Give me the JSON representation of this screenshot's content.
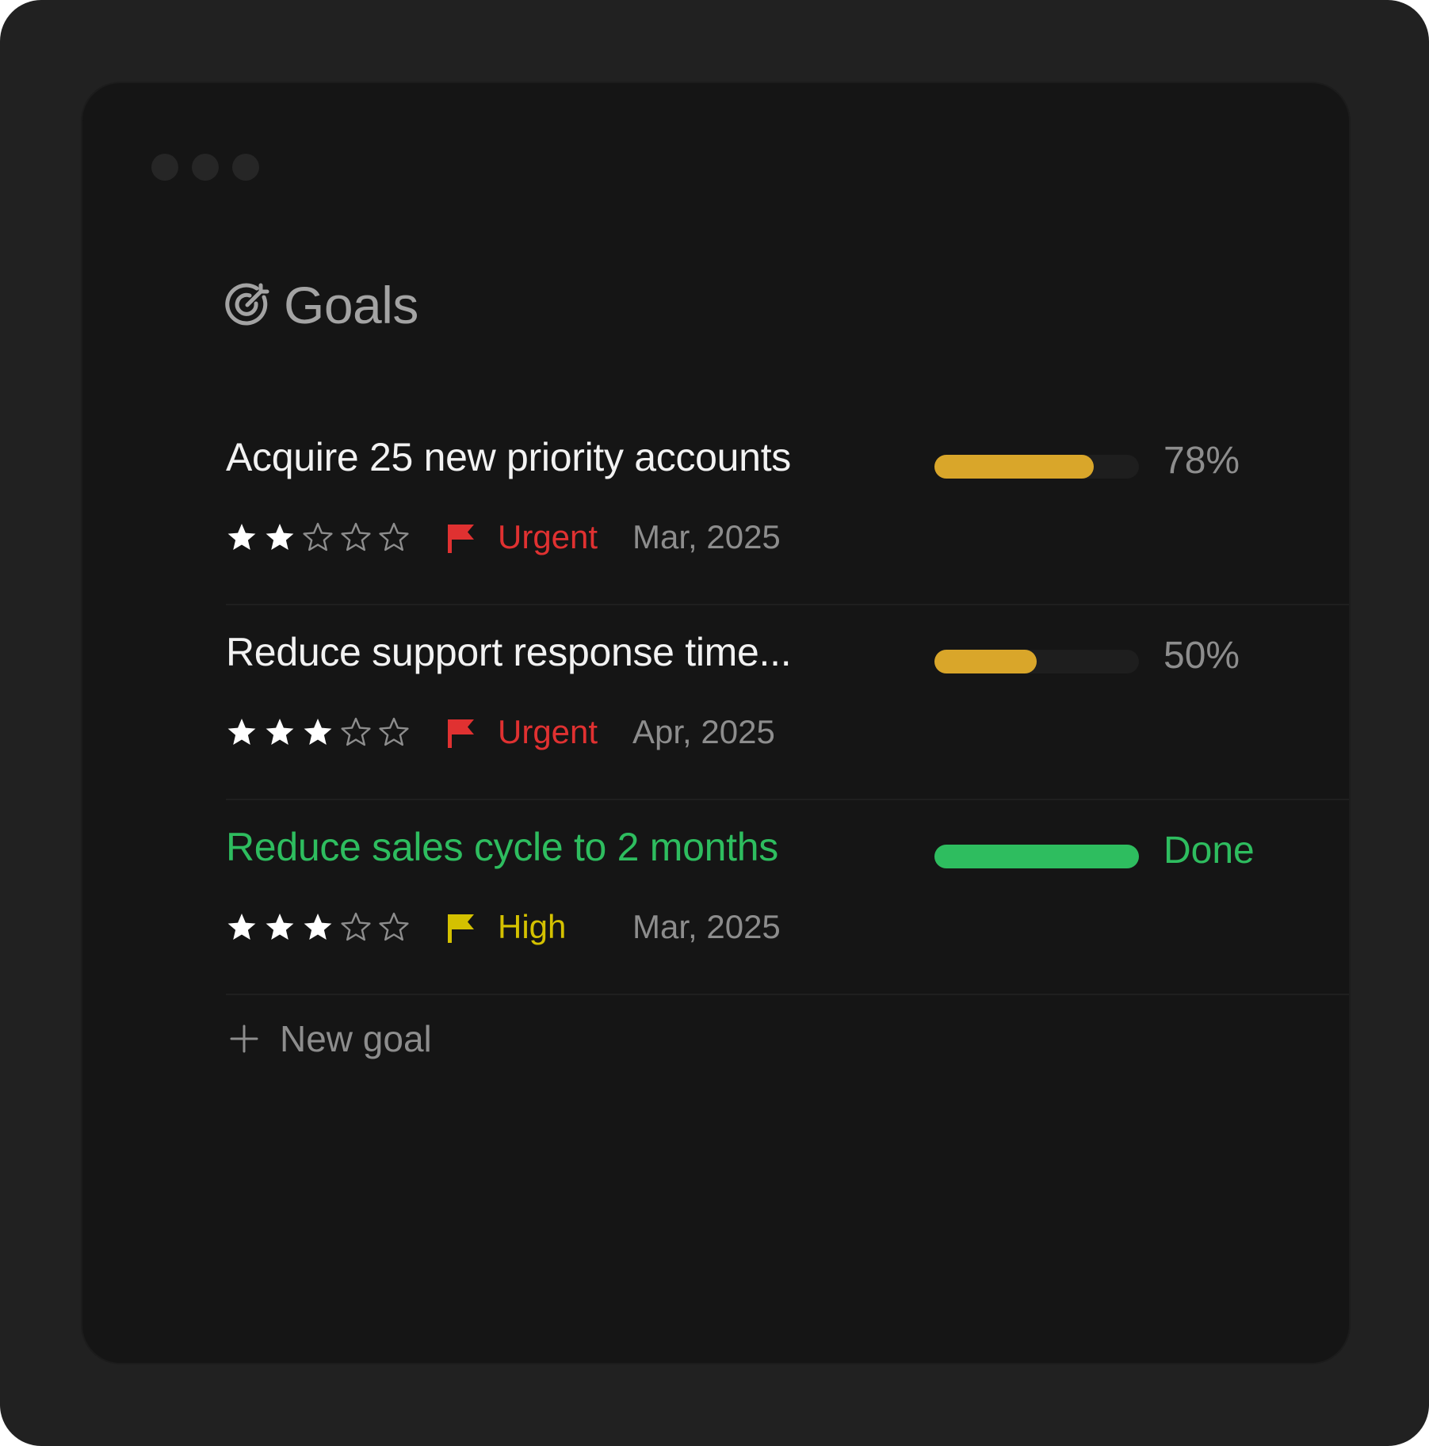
{
  "window": {
    "controls": [
      "window-dot-1",
      "window-dot-2",
      "window-dot-3"
    ]
  },
  "header": {
    "icon": "target-icon",
    "title": "Goals"
  },
  "colors": {
    "urgent": "#e03131",
    "high": "#d4c100",
    "in_progress": "#d9a62a",
    "done": "#2ebd5f",
    "star_filled": "#ffffff",
    "star_empty": "#8d8d8d"
  },
  "goals": [
    {
      "title": "Acquire 25 new priority accounts",
      "progress": 0.78,
      "progress_label": "78%",
      "status": "in_progress",
      "rating": 2,
      "rating_max": 5,
      "priority": "Urgent",
      "due": "Mar, 2025"
    },
    {
      "title": "Reduce support response time...",
      "progress": 0.5,
      "progress_label": "50%",
      "status": "in_progress",
      "rating": 3,
      "rating_max": 5,
      "priority": "Urgent",
      "due": "Apr, 2025"
    },
    {
      "title": "Reduce sales cycle to 2 months",
      "progress": 1.0,
      "progress_label": "Done",
      "status": "done",
      "rating": 3,
      "rating_max": 5,
      "priority": "High",
      "due": "Mar, 2025"
    }
  ],
  "new_goal": {
    "icon": "plus-icon",
    "label": "New goal"
  }
}
